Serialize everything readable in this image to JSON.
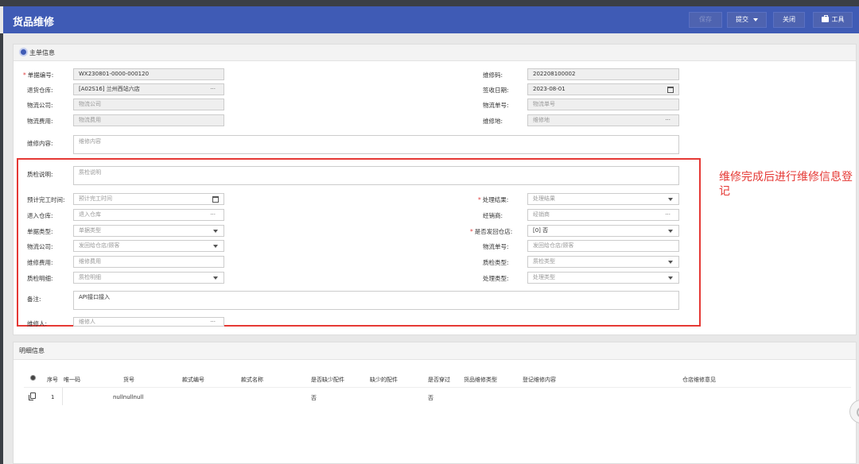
{
  "header": {
    "title": "货品维修",
    "save_label": "保存",
    "submit_label": "提交",
    "close_label": "关闭",
    "tools_label": "工具"
  },
  "main_info": {
    "section_title": "主单信息",
    "doc_no": {
      "label": "单据编号:",
      "value": "WX230801-0000-000120"
    },
    "repair_code": {
      "label": "维修码:",
      "value": "202208100002"
    },
    "return_warehouse": {
      "label": "退货仓库:",
      "value": "[A02S16] 兰州西站六店"
    },
    "receive_date": {
      "label": "签收日期:",
      "value": "2023-08-01"
    },
    "logistics_company": {
      "label": "物流公司:",
      "placeholder": "物流公司"
    },
    "logistics_no": {
      "label": "物流单号:",
      "placeholder": "物流单号"
    },
    "logistics_fee": {
      "label": "物流费用:",
      "placeholder": "物流费用"
    },
    "repair_place": {
      "label": "维修地:",
      "placeholder": "维修地"
    },
    "repair_content": {
      "label": "维修内容:",
      "placeholder": "维修内容"
    },
    "qc_desc": {
      "label": "质检说明:",
      "placeholder": "质检说明"
    },
    "est_finish": {
      "label": "预计完工时间:",
      "placeholder": "预计完工时间"
    },
    "process_result": {
      "label": "处理结果:",
      "placeholder": "处理结果"
    },
    "in_warehouse": {
      "label": "退入仓库:",
      "placeholder": "退入仓库"
    },
    "dealer": {
      "label": "经销商:",
      "placeholder": "经销商"
    },
    "doc_type": {
      "label": "单据类型:",
      "placeholder": "单据类型"
    },
    "send_back": {
      "label": "是否发回仓店:",
      "value": "[0] 否"
    },
    "logistics_company2": {
      "label": "物流公司:",
      "placeholder": "发回给仓店/顾客"
    },
    "logistics_no2": {
      "label": "物流单号:",
      "placeholder": "发回给仓店/顾客"
    },
    "repair_fee": {
      "label": "维修费用:",
      "placeholder": "维修费用"
    },
    "qc_type": {
      "label": "质检类型:",
      "placeholder": "质检类型"
    },
    "qc_detail": {
      "label": "质检明细:",
      "placeholder": "质检明细"
    },
    "process_type": {
      "label": "处理类型:",
      "placeholder": "处理类型"
    },
    "remark": {
      "label": "备注:",
      "value": "API接口接入"
    },
    "repairer": {
      "label": "维修人:",
      "placeholder": "维修人"
    }
  },
  "annotation": "维修完成后进行维修信息登记",
  "detail": {
    "section_title": "明细信息",
    "columns": [
      "序号",
      "唯一码",
      "货号",
      "款式编号",
      "款式名称",
      "是否缺少配件",
      "缺少的配件",
      "是否穿过",
      "货品维修类型",
      "登记维修内容",
      "仓店维修意见"
    ],
    "rows": [
      {
        "index": "1",
        "code": "",
        "item_no": "nullnullnull",
        "style_no": "",
        "style_name": "",
        "missing_parts": "否",
        "missing_part_name": "",
        "worn": "否",
        "repair_type": "",
        "repair_content": "",
        "store_opinion": ""
      }
    ]
  },
  "colors": {
    "header": "#3f5bb5",
    "annotation": "#e53935"
  }
}
